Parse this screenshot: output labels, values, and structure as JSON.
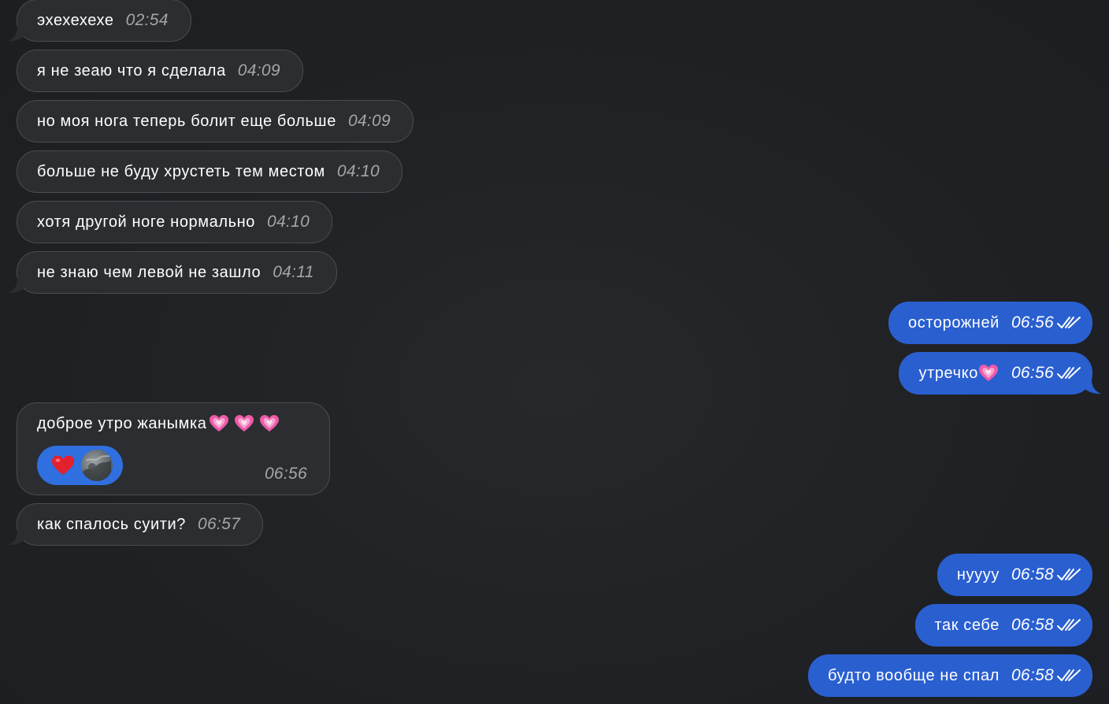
{
  "messages": [
    {
      "text": "эхехехехе",
      "time": "02:54"
    },
    {
      "text": "я не зеаю что я сделала",
      "time": "04:09"
    },
    {
      "text": "но моя нога теперь болит еще больше",
      "time": "04:09"
    },
    {
      "text": "больше не буду хрустеть тем местом",
      "time": "04:10"
    },
    {
      "text": "хотя другой ноге нормально",
      "time": "04:10"
    },
    {
      "text": "не знаю чем левой не зашло",
      "time": "04:11"
    },
    {
      "text": "осторожней",
      "time": "06:56"
    },
    {
      "text": "утречко",
      "time": "06:56",
      "emoji": "sparkling-heart-icon"
    },
    {
      "text": "доброе утро жанымка",
      "time": "06:56",
      "emoji": "sparkling-heart-icon",
      "reaction": "red-heart-icon"
    },
    {
      "text": "как спалось суити?",
      "time": "06:57"
    },
    {
      "text": "нуууу",
      "time": "06:58"
    },
    {
      "text": "так себе",
      "time": "06:58"
    },
    {
      "text": "будто вообще не спал",
      "time": "06:58"
    }
  ],
  "colors": {
    "background": "#1f2124",
    "incoming_bubble": "#2b2d30",
    "outgoing_bubble": "#2a5fd0",
    "reaction_pill": "#2f6fe0",
    "heart_pink": "#e94fa2",
    "heart_red": "#e0252f"
  }
}
